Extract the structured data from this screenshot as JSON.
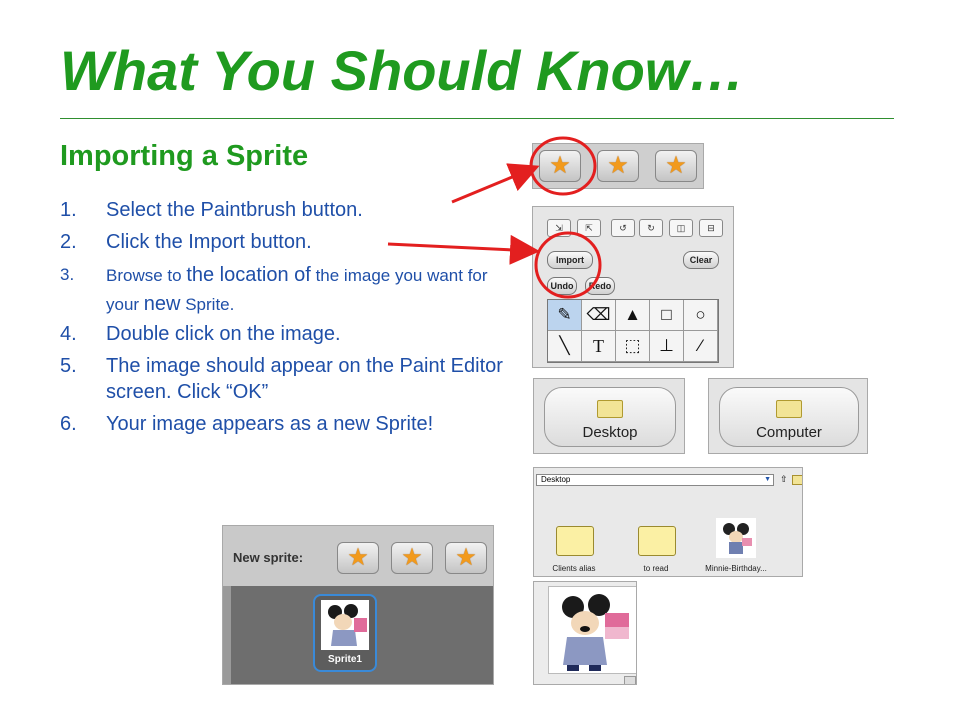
{
  "slide": {
    "title": "What You Should Know…",
    "subtitle": "Importing a Sprite",
    "steps": [
      {
        "num": "1.",
        "text": "Select the Paintbrush button."
      },
      {
        "num": "2.",
        "text": "Click the Import button."
      },
      {
        "num": "3.",
        "parts": [
          "Browse to ",
          "the location of",
          " the image you want for your ",
          "new",
          " Sprite."
        ]
      },
      {
        "num": "4.",
        "text": "Double click on the image."
      },
      {
        "num": "5.",
        "text": "The image should appear on the Paint Editor screen. Click “OK”"
      },
      {
        "num": "6.",
        "text": "Your image appears as a new Sprite!"
      }
    ]
  },
  "screenshots": {
    "paint_editor": {
      "import_label": "Import",
      "clear_label": "Clear",
      "undo_label": "Undo",
      "redo_label": "Redo",
      "text_tool": "T"
    },
    "locations": {
      "desktop_label": "Desktop",
      "computer_label": "Computer"
    },
    "file_browser": {
      "location": "Desktop",
      "files": [
        {
          "name": "Clients alias"
        },
        {
          "name": "to read"
        },
        {
          "name": "Minnie-Birthday..."
        }
      ]
    },
    "sprite_panel": {
      "new_sprite_label": "New sprite:",
      "sprite_name": "Sprite1"
    }
  },
  "colors": {
    "title_green": "#1f9a1f",
    "body_blue": "#1f4fa8",
    "annotation_red": "#e31f1f",
    "star_orange": "#f29a1c"
  }
}
